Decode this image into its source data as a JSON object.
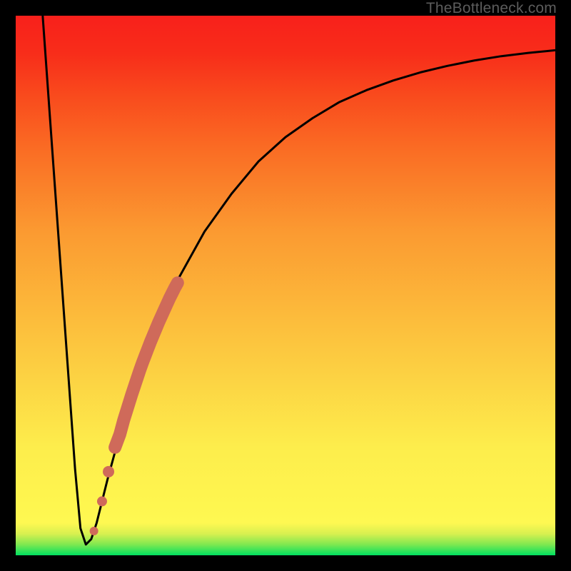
{
  "watermark": "TheBottleneck.com",
  "colors": {
    "frame": "#000000",
    "curve": "#000000",
    "marker": "#cf6a5a"
  },
  "chart_data": {
    "type": "line",
    "title": "",
    "xlabel": "",
    "ylabel": "",
    "xlim": [
      0,
      100
    ],
    "ylim": [
      0,
      100
    ],
    "series": [
      {
        "name": "bottleneck-curve",
        "x": [
          5,
          7,
          9,
          11,
          12,
          13,
          14,
          15,
          17,
          20,
          25,
          30,
          35,
          40,
          45,
          50,
          55,
          60,
          65,
          70,
          75,
          80,
          85,
          90,
          95,
          100
        ],
        "y": [
          100,
          72,
          44,
          16,
          5,
          2,
          3,
          6,
          14,
          25,
          40,
          51,
          60,
          67,
          73,
          77.5,
          81,
          84,
          86.2,
          88,
          89.5,
          90.7,
          91.7,
          92.5,
          93.1,
          93.6
        ]
      }
    ],
    "markers": {
      "name": "highlight-segment",
      "x": [
        18.4,
        19.3,
        20.0,
        20.5,
        21.0,
        21.5,
        22.0,
        22.5,
        23.0,
        23.5,
        24.0,
        24.5,
        25.0,
        25.5,
        26.0,
        26.5,
        27.0,
        27.5,
        28.0,
        28.5,
        29.0,
        29.5,
        30.0
      ],
      "y": [
        20.0,
        22.4,
        25.0,
        26.6,
        28.2,
        29.8,
        31.3,
        32.8,
        34.3,
        35.7,
        37.0,
        38.3,
        39.6,
        40.8,
        42.0,
        43.2,
        44.3,
        45.4,
        46.5,
        47.6,
        48.6,
        49.6,
        50.5
      ]
    },
    "extra_markers": {
      "x": [
        14.5,
        16.0,
        17.2
      ],
      "y": [
        4.5,
        10.0,
        15.5
      ]
    }
  }
}
